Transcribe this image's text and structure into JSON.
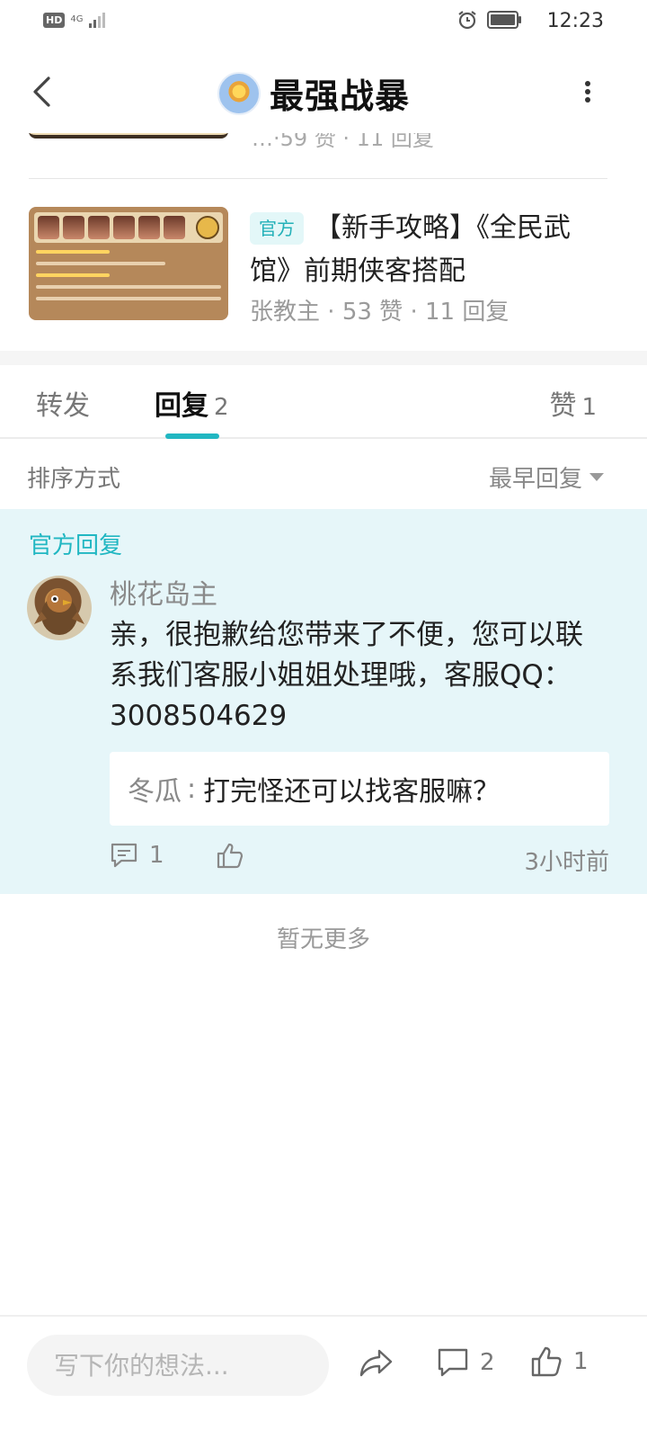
{
  "status_bar": {
    "hd": "HD",
    "network": "4G",
    "time": "12:23"
  },
  "header": {
    "title": "最强战暴"
  },
  "partial_article": {
    "meta": "…·59 赞 · 11 回复"
  },
  "article": {
    "badge": "官方",
    "title": "【新手攻略】《全民武馆》前期侠客搭配",
    "author": "张教主",
    "likes": "53 赞",
    "replies": "11 回复"
  },
  "tabs": [
    {
      "label": "转发",
      "count": ""
    },
    {
      "label": "回复",
      "count": "2"
    },
    {
      "label": "赞",
      "count": "1"
    }
  ],
  "sort": {
    "label": "排序方式",
    "selected": "最早回复"
  },
  "official_reply": {
    "label": "官方回复",
    "author": "桃花岛主",
    "content": "亲，很抱歉给您带来了不便，您可以联系我们客服小姐姐处理哦，客服QQ：3008504629",
    "quote": {
      "user": "冬瓜",
      "separator": ":",
      "text": "打完怪还可以找客服嘛？"
    },
    "comment_count": "1",
    "time": "3小时前"
  },
  "no_more": "暂无更多",
  "bottom_bar": {
    "placeholder": "写下你的想法...",
    "comment_count": "2",
    "like_count": "1"
  },
  "icons": {
    "back": "chevron-left-icon",
    "more": "more-vertical-icon",
    "comment": "comment-icon",
    "like": "thumb-up-icon",
    "share": "share-icon",
    "alarm": "alarm-icon",
    "battery": "battery-icon"
  },
  "colors": {
    "accent": "#21b7c2",
    "official_bg": "#e6f6f9"
  }
}
